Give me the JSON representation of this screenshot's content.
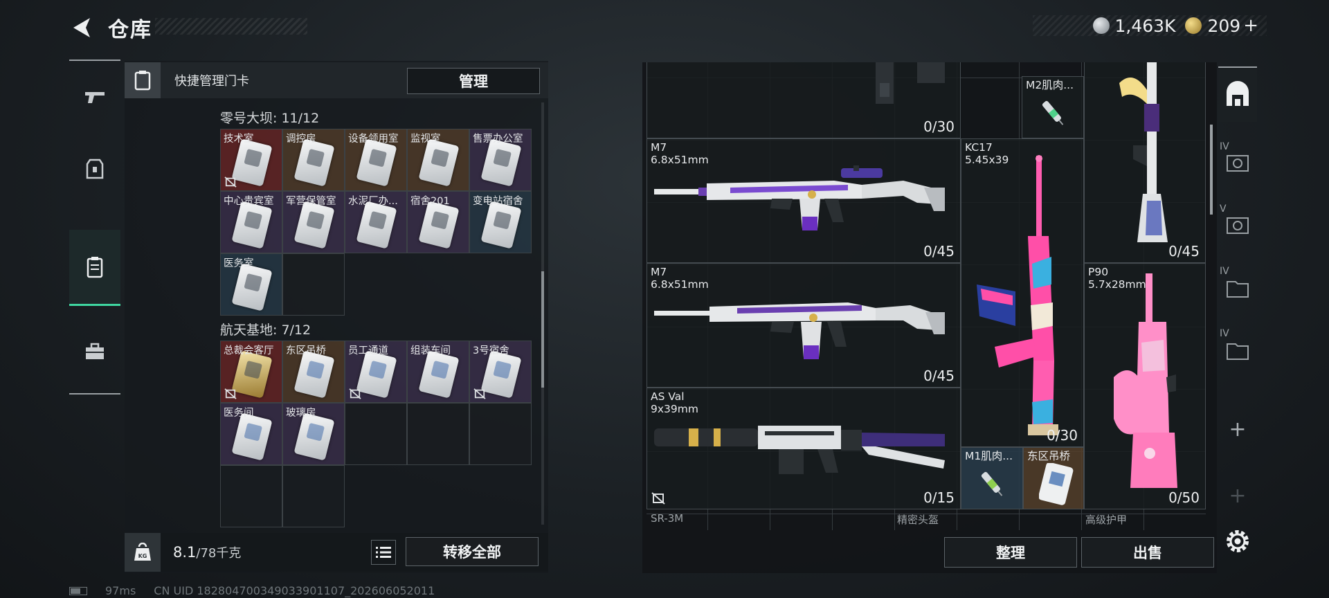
{
  "header": {
    "title": "仓库",
    "currency_silver": "1,463K",
    "currency_gold": "209",
    "gold_plus": "+"
  },
  "quick_manage": {
    "label": "快捷管理门卡",
    "button": "管理"
  },
  "sections": [
    {
      "title": "零号大坝: 11/12",
      "cells": [
        {
          "label": "技术室",
          "bg": "red",
          "card": "plain",
          "nosell": true
        },
        {
          "label": "调控房",
          "bg": "brown",
          "card": "plain",
          "nosell": false
        },
        {
          "label": "设备领用室",
          "bg": "brown",
          "card": "plain",
          "nosell": false
        },
        {
          "label": "监视室",
          "bg": "brown",
          "card": "plain",
          "nosell": false
        },
        {
          "label": "售票办公室",
          "bg": "purple",
          "card": "plain",
          "nosell": false
        },
        {
          "label": "中心贵宾室",
          "bg": "purple",
          "card": "plain",
          "nosell": false
        },
        {
          "label": "军营保管室",
          "bg": "purple",
          "card": "plain",
          "nosell": false
        },
        {
          "label": "水泥厂办...",
          "bg": "purple",
          "card": "plain",
          "nosell": false
        },
        {
          "label": "宿舍201",
          "bg": "purple",
          "card": "plain",
          "nosell": false
        },
        {
          "label": "变电站宿舍",
          "bg": "blue",
          "card": "plain",
          "nosell": false
        },
        {
          "label": "医务室",
          "bg": "blue",
          "card": "plain",
          "nosell": false
        },
        {
          "label": "",
          "bg": "empty",
          "card": "none",
          "nosell": false
        }
      ]
    },
    {
      "title": "航天基地: 7/12",
      "cells": [
        {
          "label": "总裁会客厅",
          "bg": "red",
          "card": "gold",
          "nosell": true
        },
        {
          "label": "东区吊桥",
          "bg": "brown",
          "card": "blue",
          "nosell": false
        },
        {
          "label": "员工通道",
          "bg": "purple",
          "card": "blue",
          "nosell": true
        },
        {
          "label": "组装车间",
          "bg": "purple",
          "card": "blue",
          "nosell": false
        },
        {
          "label": "3号宿舍",
          "bg": "purple",
          "card": "blue",
          "nosell": true
        },
        {
          "label": "医务间",
          "bg": "purple",
          "card": "blue",
          "nosell": false
        },
        {
          "label": "玻璃房",
          "bg": "purple",
          "card": "blue",
          "nosell": false
        },
        {
          "label": "",
          "bg": "empty",
          "card": "none",
          "nosell": false
        },
        {
          "label": "",
          "bg": "empty",
          "card": "none",
          "nosell": false
        },
        {
          "label": "",
          "bg": "empty",
          "card": "none",
          "nosell": false
        },
        {
          "label": "",
          "bg": "empty",
          "card": "none",
          "nosell": false
        },
        {
          "label": "",
          "bg": "empty",
          "card": "none",
          "nosell": false
        }
      ]
    }
  ],
  "weight": {
    "current": "8.1",
    "max": "/78千克",
    "transfer_button": "转移全部"
  },
  "stash": {
    "items": {
      "top_ammo": "0/30",
      "m2_label": "M2肌肉...",
      "m7a_name": "M7",
      "m7a_cal": "6.8x51mm",
      "m7a_ammo": "0/45",
      "kc17_name": "KC17",
      "kc17_cal": "5.45x39",
      "kc17_ammo": "0/30",
      "topright_ammo": "0/45",
      "m7b_name": "M7",
      "m7b_cal": "6.8x51mm",
      "m7b_ammo": "0/45",
      "p90_name": "P90",
      "p90_cal": "5.7x28mm",
      "p90_ammo": "0/50",
      "asval_name": "AS Val",
      "asval_cal": "9x39mm",
      "asval_ammo": "0/15",
      "m1_label": "M1肌肉...",
      "bridge_label": "东区吊桥",
      "hint_sr3m": "SR-3M",
      "hint_helmet": "精密头盔",
      "hint_armor": "高级护甲"
    },
    "sort_button": "整理",
    "sell_button": "出售"
  },
  "right_rail": {
    "levels": [
      "IV",
      "V",
      "IV",
      "IV"
    ],
    "plus": "+"
  },
  "footer": {
    "ping": "97ms",
    "uid": "CN UID 182804700349033901107_202606052011"
  },
  "colors": {
    "accent": "#3fd6a0",
    "rarity_red": "#6e2626",
    "rarity_brown": "#543e2a",
    "rarity_purple": "#3c304e",
    "rarity_blue": "#263846"
  }
}
